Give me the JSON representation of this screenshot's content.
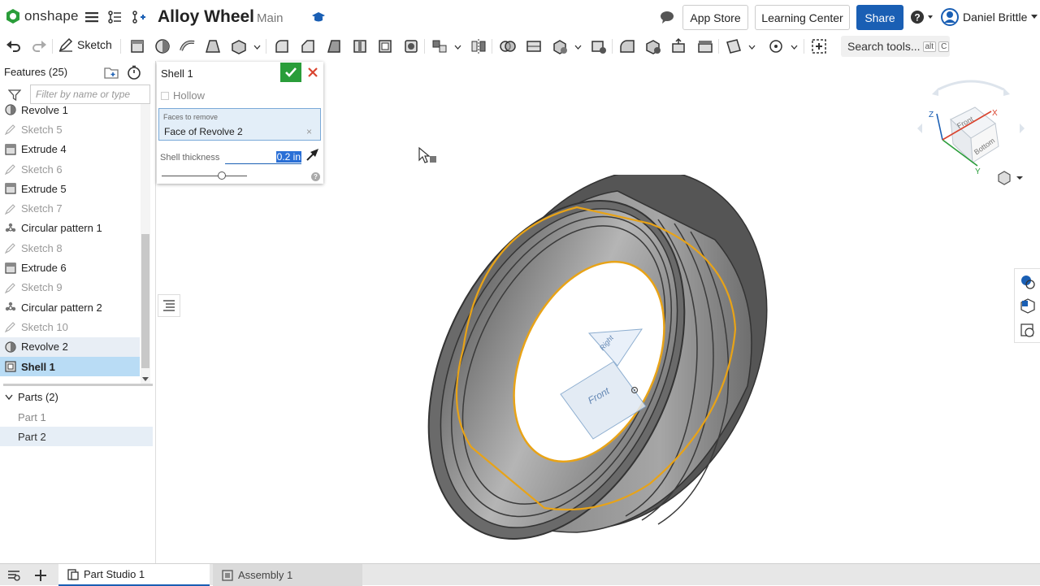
{
  "app": {
    "brand": "onshape",
    "document_title": "Alloy Wheel",
    "branch": "Main"
  },
  "header": {
    "app_store": "App Store",
    "learning_center": "Learning Center",
    "share": "Share",
    "user_name": "Daniel Brittle",
    "help_icon": "help-icon"
  },
  "toolbar": {
    "sketch_label": "Sketch",
    "search_placeholder": "Search tools...",
    "search_shortcut_1": "alt",
    "search_shortcut_2": "C"
  },
  "feature_panel": {
    "header": "Features (25)",
    "filter_placeholder": "Filter by name or type",
    "items": [
      {
        "label": "Revolve 1",
        "icon": "revolve-icon",
        "state": "normal"
      },
      {
        "label": "Sketch 5",
        "icon": "sketch-icon",
        "state": "dim"
      },
      {
        "label": "Extrude 4",
        "icon": "extrude-icon",
        "state": "normal"
      },
      {
        "label": "Sketch 6",
        "icon": "sketch-icon",
        "state": "dim"
      },
      {
        "label": "Extrude 5",
        "icon": "extrude-icon",
        "state": "normal"
      },
      {
        "label": "Sketch 7",
        "icon": "sketch-icon",
        "state": "dim"
      },
      {
        "label": "Circular pattern 1",
        "icon": "circular-pattern-icon",
        "state": "normal"
      },
      {
        "label": "Sketch 8",
        "icon": "sketch-icon",
        "state": "dim"
      },
      {
        "label": "Extrude 6",
        "icon": "extrude-icon",
        "state": "normal"
      },
      {
        "label": "Sketch 9",
        "icon": "sketch-icon",
        "state": "dim"
      },
      {
        "label": "Circular pattern 2",
        "icon": "circular-pattern-icon",
        "state": "normal"
      },
      {
        "label": "Sketch 10",
        "icon": "sketch-icon",
        "state": "dim"
      },
      {
        "label": "Revolve 2",
        "icon": "revolve-icon",
        "state": "highlight"
      },
      {
        "label": "Shell 1",
        "icon": "shell-icon",
        "state": "selected"
      }
    ],
    "parts_header": "Parts (2)",
    "parts": [
      {
        "label": "Part 1",
        "state": "normal"
      },
      {
        "label": "Part 2",
        "state": "highlight"
      }
    ]
  },
  "shell_dialog": {
    "title": "Shell 1",
    "hollow_label": "Hollow",
    "faces_label": "Faces to remove",
    "faces_value": "Face of Revolve 2",
    "thickness_label": "Shell thickness",
    "thickness_value": "0.2 in",
    "slider_fraction": 0.7
  },
  "viewcube": {
    "front": "Front",
    "bottom": "Bottom",
    "axis_x": "X",
    "axis_y": "Y",
    "axis_z": "Z"
  },
  "viewport": {
    "plane_label_1": "Front",
    "plane_label_2": "Right"
  },
  "bottom_tabs": [
    {
      "label": "Part Studio 1",
      "active": true
    },
    {
      "label": "Assembly 1",
      "active": false
    }
  ],
  "colors": {
    "accent": "#1a5fb4",
    "confirm": "#2a9d3a",
    "cancel": "#d9442f",
    "selection": "#e8a317",
    "body": "#8a8a8a"
  }
}
